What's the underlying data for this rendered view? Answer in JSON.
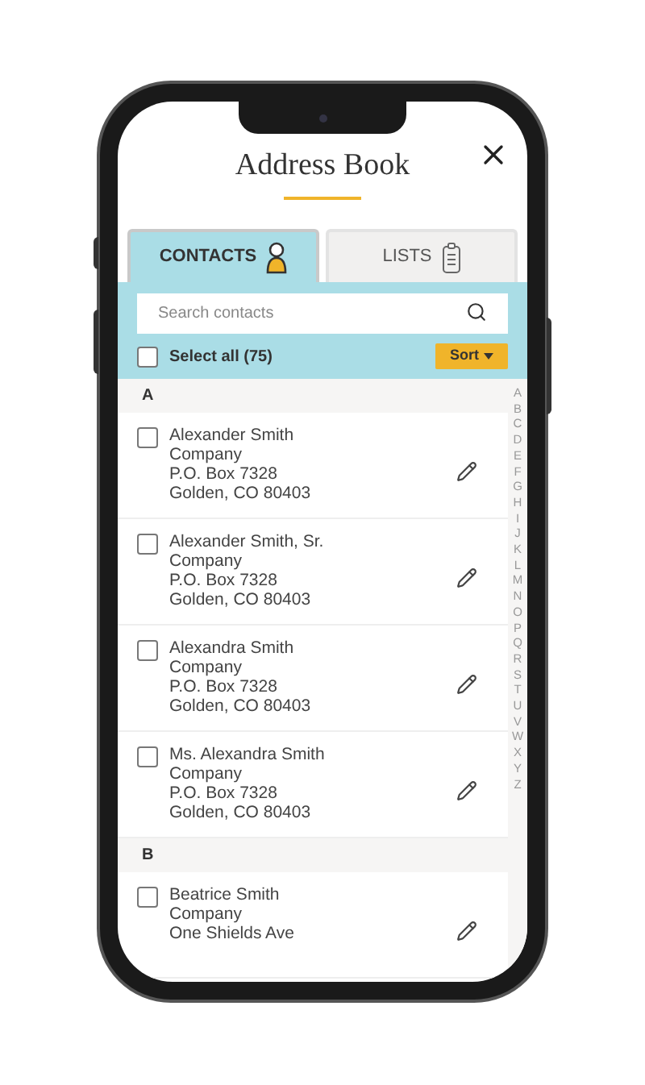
{
  "title": "Address Book",
  "tabs": [
    {
      "label": "CONTACTS",
      "selected": true,
      "kind": "person"
    },
    {
      "label": "LISTS",
      "selected": false,
      "kind": "clipboard"
    }
  ],
  "search": {
    "placeholder": "Search contacts"
  },
  "select_all": {
    "label": "Select all (75)",
    "checked": false
  },
  "sort_button": {
    "label": "Sort"
  },
  "sections": [
    {
      "letter": "A",
      "contacts": [
        {
          "checked": false,
          "lines": [
            "Alexander Smith",
            "Company",
            "P.O. Box 7328",
            "Golden, CO 80403"
          ]
        },
        {
          "checked": false,
          "lines": [
            "Alexander Smith, Sr.",
            "Company",
            "P.O. Box 7328",
            "Golden, CO 80403"
          ]
        },
        {
          "checked": false,
          "lines": [
            "Alexandra Smith",
            "Company",
            "P.O. Box 7328",
            "Golden, CO 80403"
          ]
        },
        {
          "checked": false,
          "lines": [
            "Ms. Alexandra Smith",
            "Company",
            "P.O. Box 7328",
            "Golden, CO 80403"
          ]
        }
      ]
    },
    {
      "letter": "B",
      "contacts": [
        {
          "checked": false,
          "lines": [
            "Beatrice Smith",
            "Company",
            "One Shields Ave"
          ]
        }
      ]
    }
  ],
  "index": [
    "A",
    "B",
    "C",
    "D",
    "E",
    "F",
    "G",
    "H",
    "I",
    "J",
    "K",
    "L",
    "M",
    "N",
    "O",
    "P",
    "Q",
    "R",
    "S",
    "T",
    "U",
    "V",
    "W",
    "X",
    "Y",
    "Z"
  ]
}
